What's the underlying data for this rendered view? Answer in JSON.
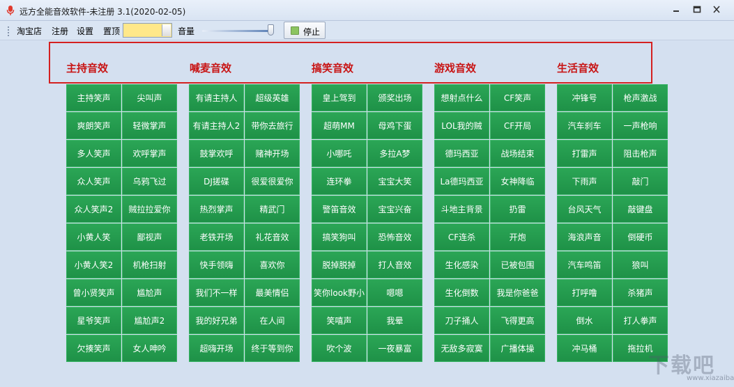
{
  "window": {
    "title": "远方全能音效软件-未注册 3.1(2020-02-05)"
  },
  "menu": {
    "items": [
      "淘宝店",
      "注册",
      "设置",
      "置顶"
    ]
  },
  "volume": {
    "label": "音量",
    "level": 0.95
  },
  "stop_button": {
    "label": "停止"
  },
  "categories": [
    {
      "title": "主持音效",
      "buttons": [
        "主持笑声",
        "尖叫声",
        "爽朗笑声",
        "轻微掌声",
        "多人笑声",
        "欢呼掌声",
        "众人笑声",
        "乌鸦飞过",
        "众人笑声2",
        "贼拉拉爱你",
        "小黄人笑",
        "鄙视声",
        "小黄人笑2",
        "机枪扫射",
        "曾小贤笑声",
        "尴尬声",
        "星爷笑声",
        "尴尬声2",
        "欠揍笑声",
        "女人呻吟"
      ]
    },
    {
      "title": "喊麦音效",
      "buttons": [
        "有请主持人",
        "超级英雄",
        "有请主持人2",
        "带你去旅行",
        "鼓掌欢呼",
        "赌神开场",
        "DJ搓碟",
        "很爱很爱你",
        "热烈掌声",
        "精武门",
        "老铁开场",
        "礼花音效",
        "快手领嗨",
        "喜欢你",
        "我们不一样",
        "最美情侣",
        "我的好兄弟",
        "在人间",
        "超嗨开场",
        "终于等到你"
      ]
    },
    {
      "title": "搞笑音效",
      "buttons": [
        "皇上驾到",
        "颁奖出场",
        "超萌MM",
        "母鸡下蛋",
        "小哪吒",
        "多拉A梦",
        "连环拳",
        "宝宝大笑",
        "警笛音效",
        "宝宝兴奋",
        "搞笑狗叫",
        "恐怖音效",
        "脱掉脱掉",
        "打人音效",
        "笑你look野小",
        "嗯嗯",
        "笑嘻声",
        "我晕",
        "吹个波",
        "一夜暴富"
      ]
    },
    {
      "title": "游戏音效",
      "buttons": [
        "想射点什么",
        "CF笑声",
        "LOL我的贼",
        "CF开局",
        "德玛西亚",
        "战场结束",
        "La德玛西亚",
        "女神降临",
        "斗地主背景",
        "扔雷",
        "CF连杀",
        "开炮",
        "生化感染",
        "已被包围",
        "生化倒数",
        "我是你爸爸",
        "刀子捅人",
        "飞得更高",
        "无敌多寂寞",
        "广播体操"
      ]
    },
    {
      "title": "生活音效",
      "buttons": [
        "冲锋号",
        "枪声激战",
        "汽车刹车",
        "一声枪响",
        "打雷声",
        "阻击枪声",
        "下雨声",
        "敲门",
        "台风天气",
        "敲键盘",
        "海浪声音",
        "倒硬币",
        "汽车鸣笛",
        "狼叫",
        "打呼噜",
        "杀猪声",
        "倒水",
        "打人拳声",
        "冲马桶",
        "拖拉机"
      ]
    }
  ],
  "watermark": {
    "text": "下载吧",
    "url": "www.xiazaiba.com"
  }
}
